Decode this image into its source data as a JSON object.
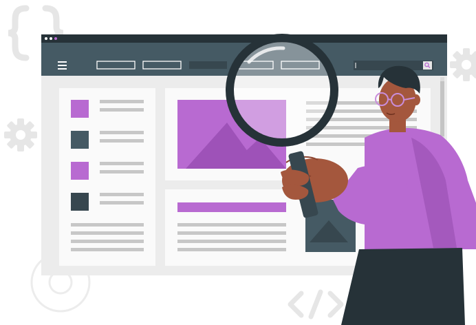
{
  "illustration": {
    "colors": {
      "accent": "#b86ad1",
      "accent_light": "#c98ddb",
      "dark": "#37474f",
      "frame_dark": "#455a64",
      "panel_bg": "#e0e0e0",
      "card_bg": "#fafafa",
      "line_gray": "#c7c7c7",
      "skin": "#a4573d",
      "hair": "#263238",
      "pants": "#263238",
      "decor_gray": "#ebebeb"
    },
    "icons": [
      "curly-braces-icon",
      "gear-icon",
      "code-tag-icon",
      "hamburger-menu-icon",
      "search-icon",
      "image-placeholder-icon",
      "magnifying-glass-icon"
    ]
  }
}
